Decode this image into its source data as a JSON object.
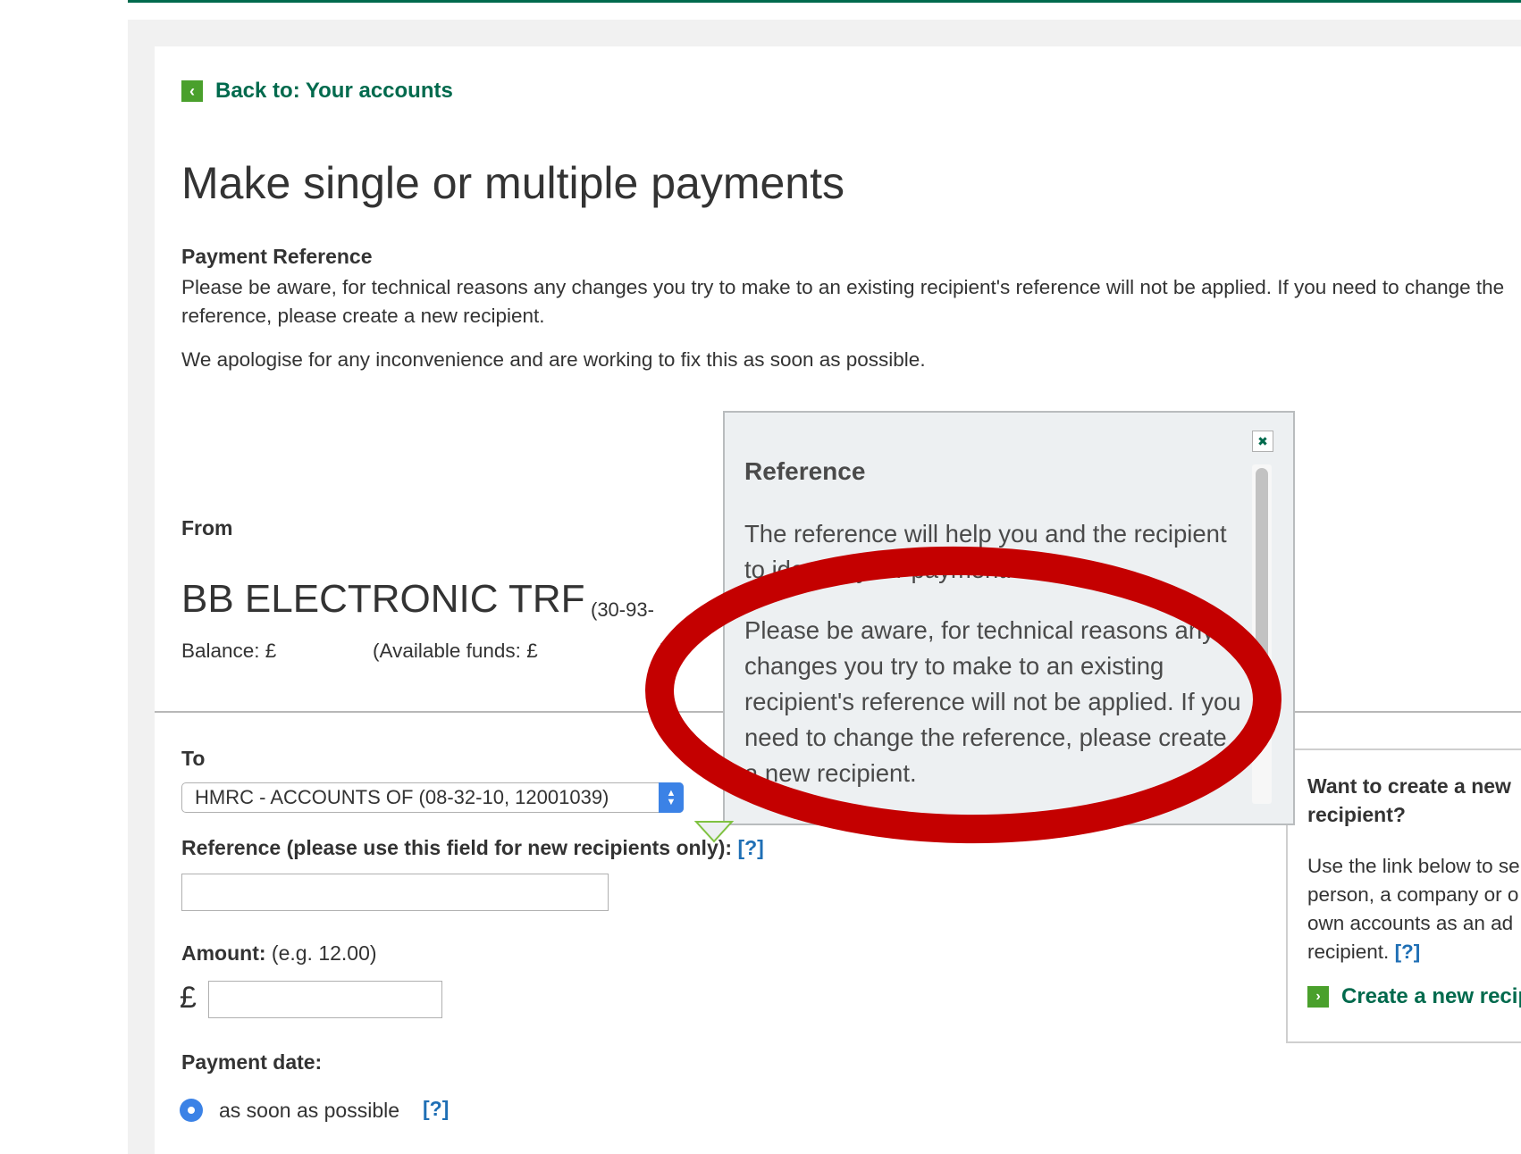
{
  "nav": {
    "back_label": "Back to: Your accounts"
  },
  "page": {
    "title": "Make single or multiple payments"
  },
  "notice": {
    "title": "Payment Reference",
    "text": "Please be aware, for technical reasons any changes you try to make to an existing recipient's reference will not be applied. If you need to change the reference, please create a new recipient.",
    "apology": "We apologise for any inconvenience and are working to fix this as soon as possible."
  },
  "from": {
    "label": "From",
    "account_name": "BB ELECTRONIC TRF",
    "sort_code": "(30-93-",
    "balance_label": "Balance: £",
    "available_label": "(Available funds: £",
    "close_paren": ")"
  },
  "to": {
    "label": "To",
    "selected": "HMRC - ACCOUNTS OF (08-32-10, 12001039)"
  },
  "reference": {
    "label": "Reference (please use this field for new recipients only):",
    "help": "[?]",
    "value": ""
  },
  "amount": {
    "label": "Amount:",
    "hint": "(e.g. 12.00)",
    "currency": "£",
    "value": ""
  },
  "payment_date": {
    "label": "Payment date:",
    "option_label": "as soon as possible",
    "help": "[?]"
  },
  "side_panel": {
    "title": "Want to create a new recipient?",
    "text_lines": [
      "Use the link below to se",
      "person, a company or o",
      "own accounts as an ad",
      "recipient."
    ],
    "help": "[?]",
    "link_label": "Create a new recip"
  },
  "popover": {
    "close_glyph": "✖",
    "title": "Reference",
    "para1": "The reference will help you and the recipient to identify your payment.",
    "para2": "Please be aware, for technical reasons any changes you try to make to an existing recipient's reference will not be applied. If you need to change the reference, please create a new recipient."
  },
  "colors": {
    "brand_green": "#006a4d",
    "icon_green": "#4aa02c",
    "link_blue": "#1f6fb5",
    "select_blue": "#3b82e6",
    "annotation_red": "#c40000"
  }
}
